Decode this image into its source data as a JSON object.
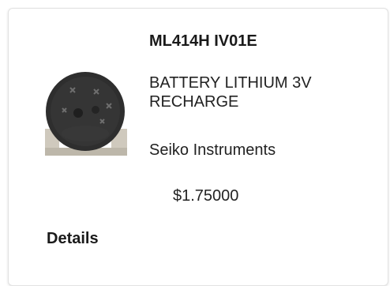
{
  "product": {
    "part_number": "ML414H IV01E",
    "description": "BATTERY LITHIUM 3V RECHARGE",
    "manufacturer": "Seiko Instruments",
    "price": "$1.75000",
    "details_label": "Details",
    "image_icon": "battery-image"
  },
  "colors": {
    "battery_body": "#2c2c2c",
    "battery_tab": "#c9c4b8"
  }
}
